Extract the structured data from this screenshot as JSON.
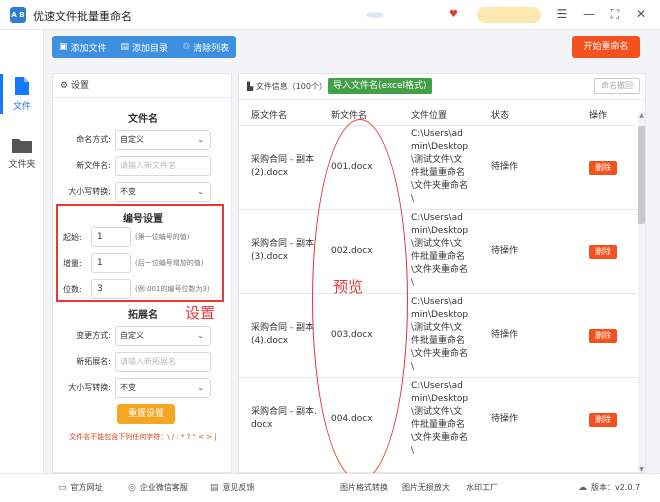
{
  "app": {
    "title": "优速文件批量重命名",
    "logo_text": "A B"
  },
  "window_controls": {
    "menu": "☰",
    "minimize": "—",
    "maximize": "⛶",
    "close": "✕"
  },
  "leftnav": {
    "items": [
      {
        "label": "文件",
        "icon": "file-icon",
        "active": true
      },
      {
        "label": "文件夹",
        "icon": "folder-icon",
        "active": false
      }
    ]
  },
  "toolbar": {
    "add_file": "添加文件",
    "add_dir": "添加目录",
    "clear_list": "清除列表",
    "start": "开始重命名"
  },
  "settings": {
    "header": "设置",
    "filename_section": "文件名",
    "naming_mode_label": "命名方式:",
    "naming_mode_value": "自定义",
    "new_name_label": "新文件名:",
    "new_name_placeholder": "请输入新文件名",
    "case_label": "大小写转换:",
    "case_value": "不变",
    "numbering_section": "编号设置",
    "start_label": "起始:",
    "start_value": "1",
    "start_hint": "(第一位编号的值)",
    "step_label": "增量:",
    "step_value": "1",
    "step_hint": "(后一位编号增加的值)",
    "digits_label": "位数:",
    "digits_value": "3",
    "digits_hint": "(例:001的编号位数为3)",
    "ext_section": "拓展名",
    "ext_mode_label": "变更方式:",
    "ext_mode_value": "自定义",
    "new_ext_label": "新拓展名:",
    "new_ext_placeholder": "请输入新拓展名",
    "ext_case_label": "大小写转换:",
    "ext_case_value": "不变",
    "reset": "重置设置",
    "warning": "文件名不能包含下列任何字符：\\ / : * ? \" < > |"
  },
  "filelist": {
    "info": "文件信息（100个）",
    "import_btn": "导入文件名(excel格式)",
    "restore_btn": "命名撤回",
    "columns": [
      "原文件名",
      "新文件名",
      "文件位置",
      "状态",
      "操作"
    ],
    "rows": [
      {
        "orig": "采购合同 - 副本 (2).docx",
        "new": "001.docx",
        "path": "C:\\Users\\admin\\Desktop\\测试文件\\文件批量重命名\\文件夹重命名\\",
        "status": "待操作",
        "action": "删除"
      },
      {
        "orig": "采购合同 - 副本 (3).docx",
        "new": "002.docx",
        "path": "C:\\Users\\admin\\Desktop\\测试文件\\文件批量重命名\\文件夹重命名\\",
        "status": "待操作",
        "action": "删除"
      },
      {
        "orig": "采购合同 - 副本 (4).docx",
        "new": "003.docx",
        "path": "C:\\Users\\admin\\Desktop\\测试文件\\文件批量重命名\\文件夹重命名\\",
        "status": "待操作",
        "action": "删除"
      },
      {
        "orig": "采购合同 - 副本.docx",
        "new": "004.docx",
        "path": "C:\\Users\\admin\\Desktop\\测试文件\\文件批量重命名\\文件夹重命名\\",
        "status": "待操作",
        "action": "删除"
      }
    ]
  },
  "annotations": {
    "settings_note": "设置",
    "preview_note": "预览",
    "color": "#e53935"
  },
  "footer": {
    "left": [
      {
        "label": "官方网址",
        "icon": "monitor-icon"
      },
      {
        "label": "企业微信客服",
        "icon": "chat-icon"
      },
      {
        "label": "意见反馈",
        "icon": "feedback-icon"
      }
    ],
    "right": [
      "图片格式转换",
      "图片无损放大",
      "水印工厂"
    ],
    "version": "版本：v2.0.7"
  },
  "colors": {
    "accent": "#1677ff",
    "toolbar": "#3d8fe0",
    "start": "#f4511e",
    "import": "#43a047",
    "reset": "#f5a623"
  }
}
